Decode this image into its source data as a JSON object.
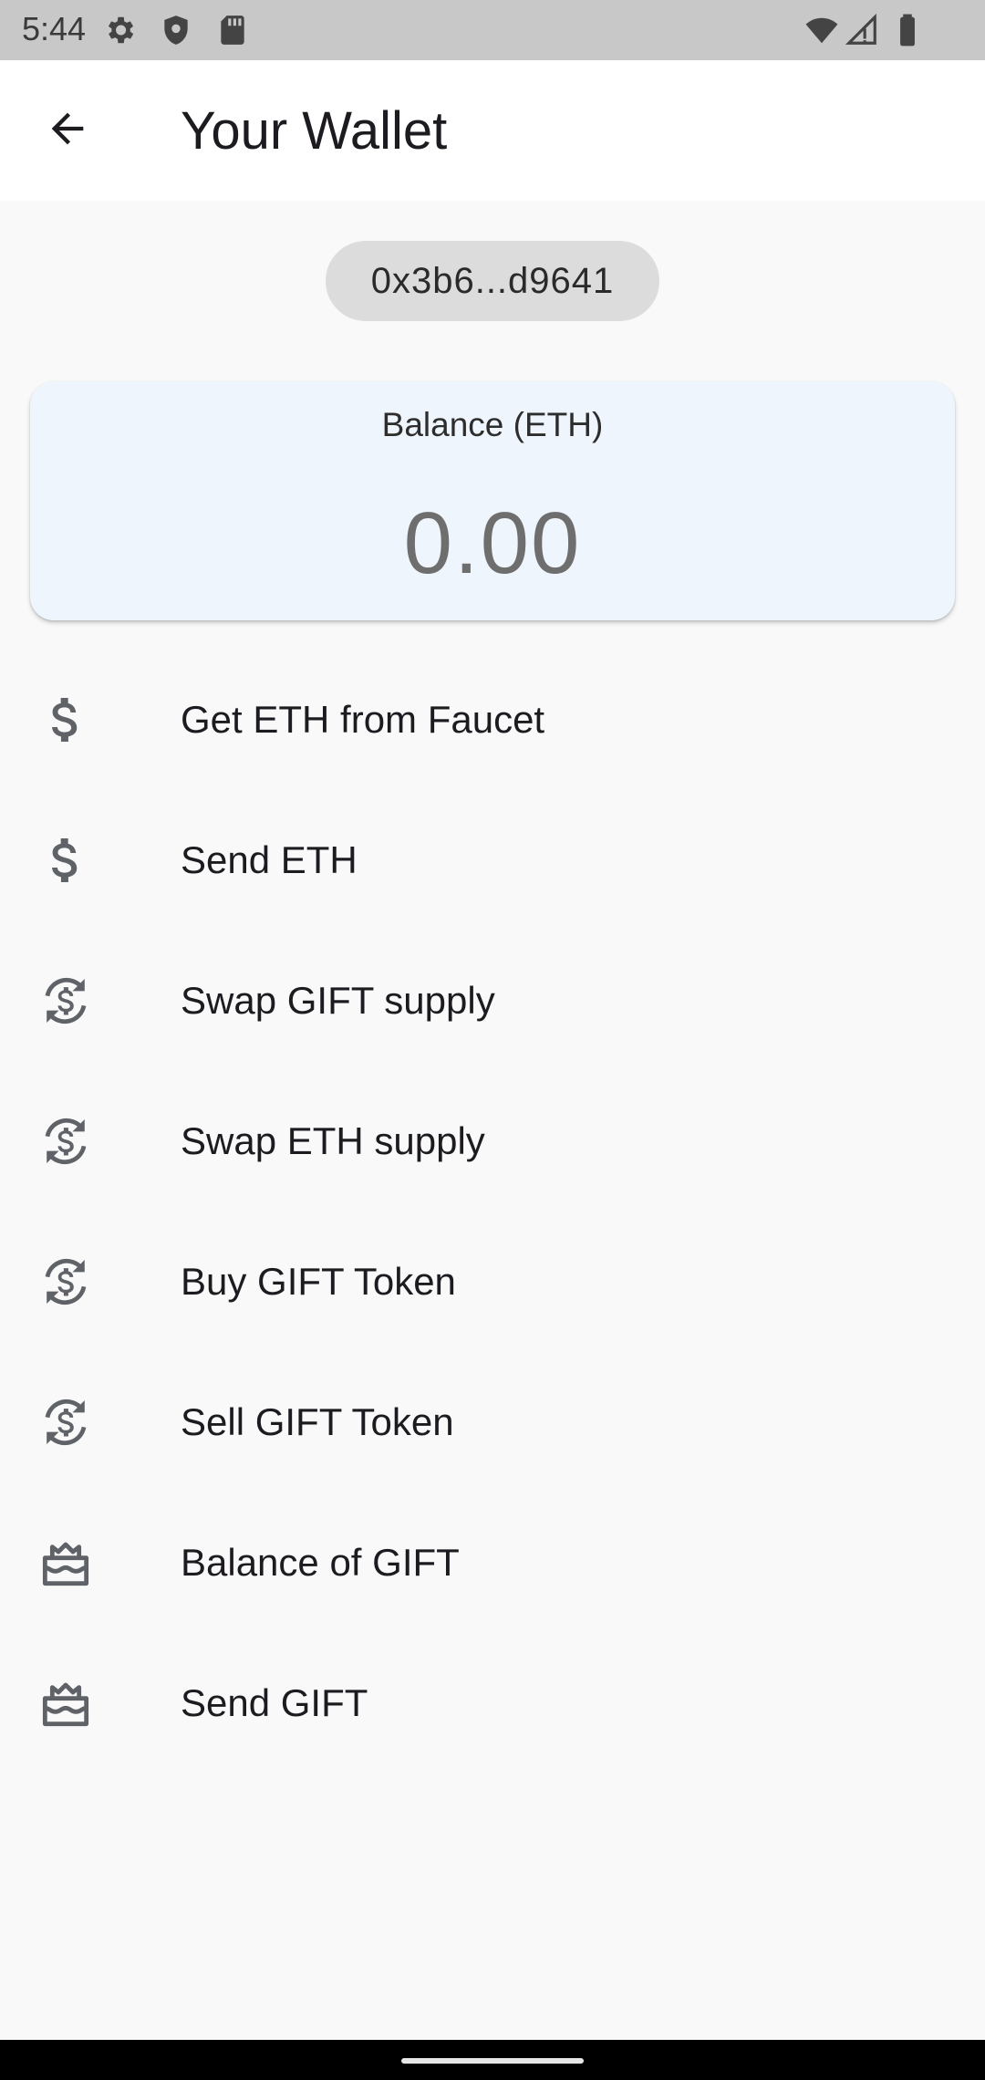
{
  "status_bar": {
    "time": "5:44",
    "left_icons": [
      "gear-icon",
      "shield-icon",
      "sd-card-icon"
    ],
    "right_icons": [
      "wifi-icon",
      "signal-icon",
      "battery-icon"
    ]
  },
  "app_bar": {
    "back_icon": "arrow-back-icon",
    "title": "Your Wallet"
  },
  "wallet": {
    "address": "0x3b6...d9641"
  },
  "balance": {
    "label": "Balance (ETH)",
    "value": "0.00"
  },
  "menu": {
    "items": [
      {
        "label": "Get ETH from Faucet",
        "icon": "dollar-icon"
      },
      {
        "label": "Send ETH",
        "icon": "dollar-icon"
      },
      {
        "label": "Swap GIFT supply",
        "icon": "currency-exchange-icon"
      },
      {
        "label": "Swap ETH supply",
        "icon": "currency-exchange-icon"
      },
      {
        "label": "Buy GIFT Token",
        "icon": "currency-exchange-icon"
      },
      {
        "label": "Sell GIFT Token",
        "icon": "currency-exchange-icon"
      },
      {
        "label": "Balance of GIFT",
        "icon": "cake-icon"
      },
      {
        "label": "Send GIFT",
        "icon": "cake-icon"
      }
    ]
  },
  "colors": {
    "status_bar": "#c8c8c8",
    "app_bar": "#ffffff",
    "background": "#f9f9f9",
    "card": "#eff5fd",
    "chip": "#dcdcdc",
    "icon": "#5f6368",
    "nav_bar": "#000000"
  }
}
